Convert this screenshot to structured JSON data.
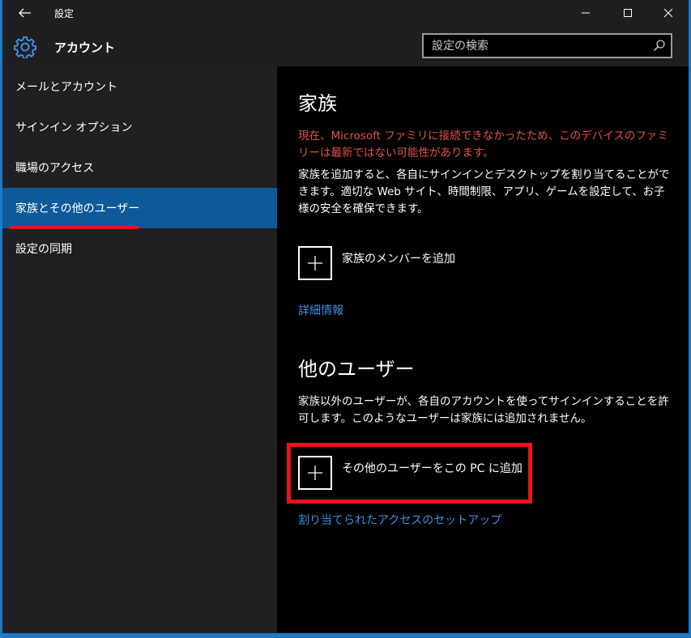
{
  "window": {
    "title": "設定",
    "icons": {
      "back": "back-arrow-icon",
      "minimize": "minimize-icon",
      "maximize": "maximize-icon",
      "close": "close-icon"
    }
  },
  "header": {
    "app_title": "アカウント",
    "gear_icon": "gear-icon",
    "search_placeholder": "設定の検索"
  },
  "sidebar": {
    "items": [
      {
        "label": "メールとアカウント",
        "active": false
      },
      {
        "label": "サインイン オプション",
        "active": false
      },
      {
        "label": "職場のアクセス",
        "active": false
      },
      {
        "label": "家族とその他のユーザー",
        "active": true
      },
      {
        "label": "設定の同期",
        "active": false
      }
    ]
  },
  "main": {
    "family": {
      "title": "家族",
      "warning": "現在、Microsoft ファミリに接続できなかったため、このデバイスのファミリーは最新ではない可能性があります。",
      "description": "家族を追加すると、各自にサインインとデスクトップを割り当てることができます。適切な Web サイト、時間制限、アプリ、ゲームを設定して、お子様の安全を確保できます。",
      "add_label": "家族のメンバーを追加",
      "link": "詳細情報"
    },
    "others": {
      "title": "他のユーザー",
      "description": "家族以外のユーザーが、各自のアカウントを使ってサインインすることを許可します。このようなユーザーは家族には追加されません。",
      "add_label": "その他のユーザーをこの PC に追加",
      "link": "割り当てられたアクセスのセットアップ"
    }
  },
  "colors": {
    "accent": "#0e5a98",
    "warning": "#e2504a",
    "link": "#3d8fe0",
    "highlight": "#e8141c"
  }
}
